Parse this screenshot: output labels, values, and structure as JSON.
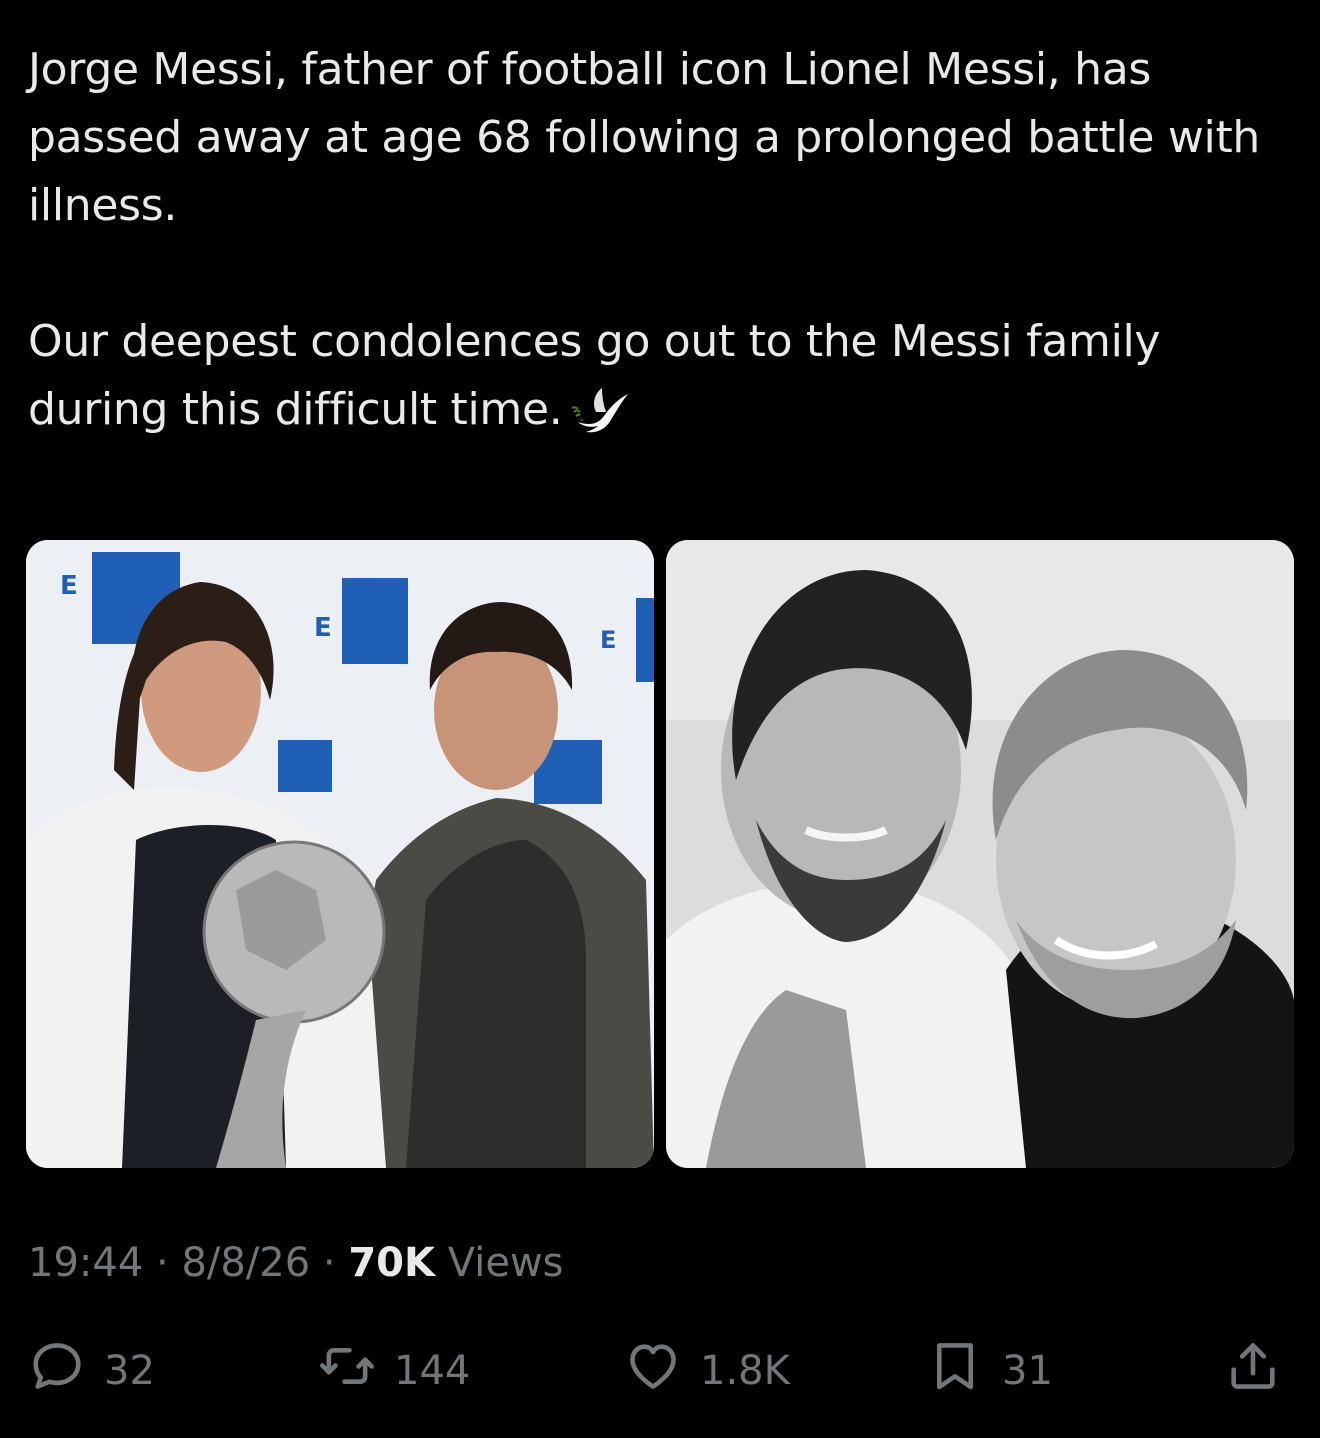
{
  "tweet": {
    "paragraphs": [
      "Jorge Messi, father of football icon Lionel Messi, has passed away at age 68 following a prolonged battle with illness.",
      "Our deepest condolences go out to the Messi family during this difficult time."
    ],
    "emoji": "dove-emoji",
    "media": [
      {
        "description_icon": "photo",
        "tone": "color",
        "logo_text": "EFE"
      },
      {
        "description_icon": "photo",
        "tone": "black-and-white"
      }
    ],
    "meta": {
      "time": "19:44",
      "separator": "·",
      "date": "8/8/26",
      "views_count": "70K",
      "views_label": "Views"
    },
    "actions": {
      "reply": {
        "icon": "reply-icon",
        "count": "32"
      },
      "retweet": {
        "icon": "retweet-icon",
        "count": "144"
      },
      "like": {
        "icon": "heart-icon",
        "count": "1.8K"
      },
      "bookmark": {
        "icon": "bookmark-icon",
        "count": "31"
      },
      "share": {
        "icon": "share-icon"
      }
    }
  },
  "colors": {
    "background": "#000000",
    "text": "#e7e9ea",
    "muted": "#71767b",
    "efe_blue": "#1f5fb5"
  }
}
